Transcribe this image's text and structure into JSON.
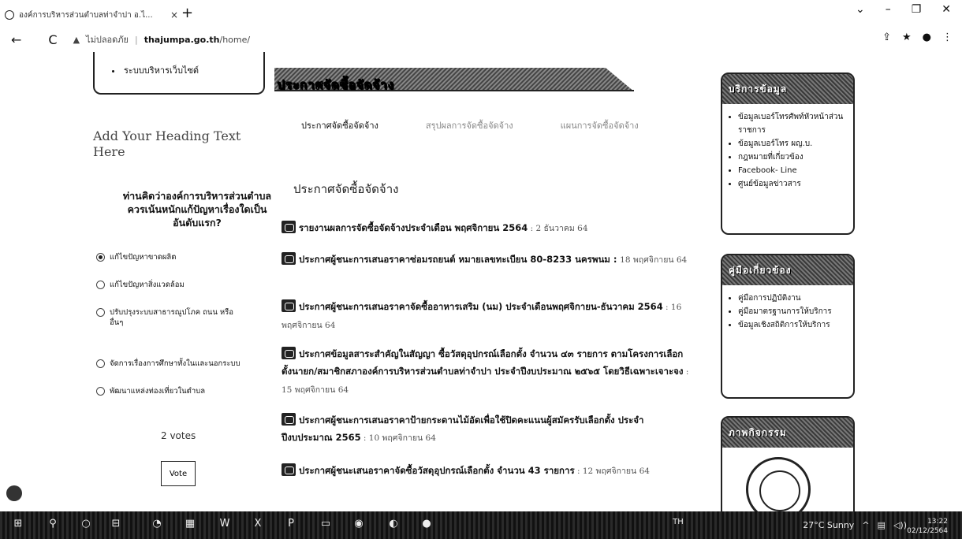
{
  "browser": {
    "tab_title": "องค์การบริหารส่วนตำบลท่าจำปา อ.ไ...",
    "tab_close": "×",
    "new_tab": "+",
    "security_label": "ไม่ปลอดภัย",
    "url_host": "thajumpa.go.th",
    "url_path": "/home/",
    "back": "←",
    "reload": "C"
  },
  "left": {
    "menu_item": "ระบบบริหารเว็บไซต์",
    "heading": "Add Your Heading Text Here",
    "poll_question": "ท่านคิดว่าองค์การบริหารส่วนตำบล ควรเน้นหนักแก้ปัญหาเรื่องใดเป็นอันดับแรก?",
    "poll_options": [
      "แก้ไขปัญหาขาดผลิต",
      "แก้ไขปัญหาสิ่งแวดล้อม",
      "ปรับปรุงระบบสาธารณูปโภค ถนน หรืออื่นๆ",
      "จัดการเรื่องการศึกษาทั้งในและนอกระบบ",
      "พัฒนาแหล่งท่องเที่ยวในตำบล"
    ],
    "votes": "2 votes",
    "vote_button": "Vote"
  },
  "main": {
    "banner_title": "ประกาศจัดซื้อจัดจ้าง",
    "tabs": [
      "ประกาศจัดซื้อจัดจ้าง",
      "สรุปผลการจัดซื้อจัดจ้าง",
      "แผนการจัดซื้อจัดจ้าง"
    ],
    "subheading": "ประกาศจัดซื้อจัดจ้าง",
    "announcements": [
      {
        "title": "รายงานผลการจัดซื้อจัดจ้างประจำเดือน พฤศจิกายน 2564",
        "date": " : 2 ธันวาคม 64"
      },
      {
        "title": "ประกาศผู้ชนะการเสนอราคาซ่อมรถยนต์ หมายเลขทะเบียน 80-8233 นครพนม :",
        "date": "18 พฤศจิกายน 64"
      },
      {
        "title": "ประกาศผู้ชนะการเสนอราคาจัดซื้ออาหารเสริม (นม) ประจำเดือนพฤศจิกายน-ธันวาคม 2564",
        "date": " : 16 พฤศจิกายน 64"
      },
      {
        "title": "ประกาศข้อมูลสาระสำคัญในสัญญา ซื้อวัสดุอุปกรณ์เลือกตั้ง จำนวน ๔๓ รายการ ตามโครงการเลือกตั้งนายก/สมาชิกสภาองค์การบริหารส่วนตำบลท่าจำปา ประจำปีงบประมาณ ๒๕๖๕ โดยวิธีเฉพาะเจาะจง",
        "date": " : 15 พฤศจิกายน 64"
      },
      {
        "title": "ประกาศผู้ชนะการเสนอราคาป้ายกระดานไม้อัดเพื่อใช้ปิดคะแนนผู้สมัครรับเลือกตั้ง ประจำปีงบประมาณ 2565",
        "date": " : 10 พฤศจิกายน 64"
      },
      {
        "title": "ประกาศผู้ชนะเสนอราคาจัดซื้อวัสดุอุปกรณ์เลือกตั้ง จำนวน 43 รายการ",
        "date": " : 12 พฤศจิกายน 64"
      }
    ]
  },
  "right": {
    "service_title": "บริการข้อมูล",
    "service_items": [
      "ข้อมูลเบอร์โทรศัพท์หัวหน้าส่วนราชการ",
      "ข้อมูลเบอร์โทร ผญ.บ.",
      "กฎหมายที่เกี่ยวข้อง",
      "Facebook- Line",
      "ศูนย์ข้อมูลข่าวสาร"
    ],
    "manual_title": "คู่มือเกี่ยวข้อง",
    "manual_items": [
      "คู่มือการปฏิบัติงาน",
      "คู่มือมาตรฐานการให้บริการ",
      "ข้อมูลเชิงสถิติการให้บริการ"
    ],
    "activity_title": "ภาพกิจกรรม"
  },
  "taskbar": {
    "weather": "27°C Sunny",
    "lang": "TH",
    "time": "13:22",
    "date": "02/12/2564"
  }
}
